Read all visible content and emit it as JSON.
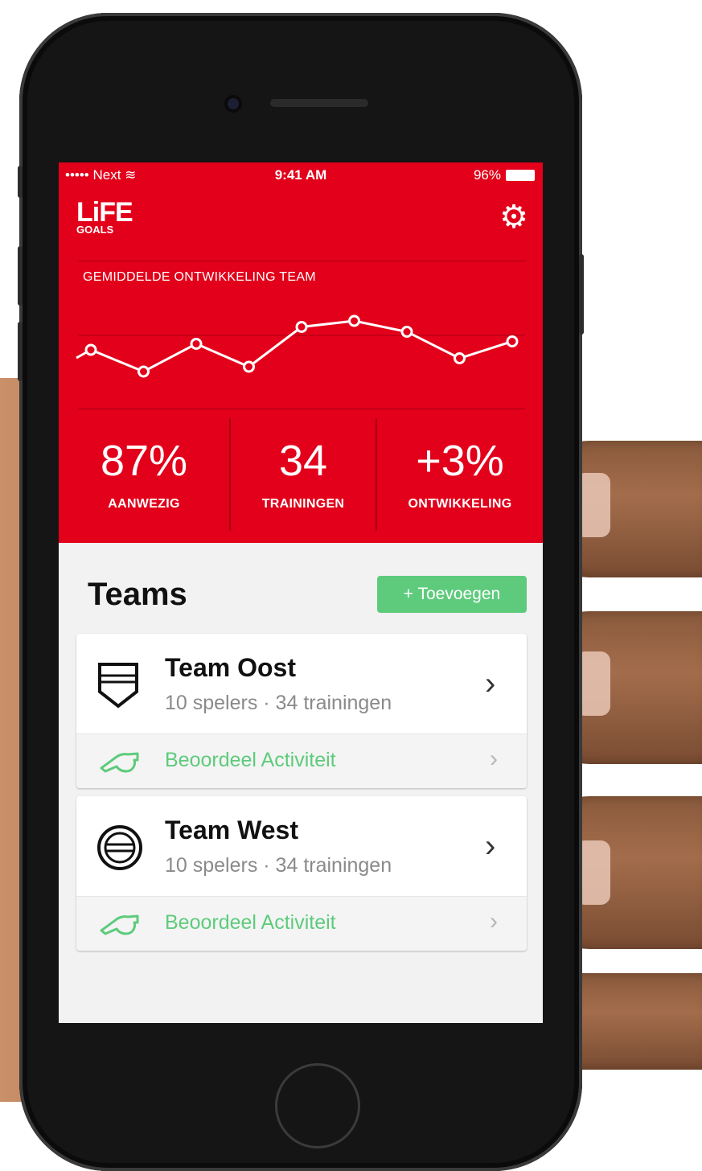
{
  "status_bar": {
    "carrier": "••••• Next",
    "time": "9:41 AM",
    "battery": "96%"
  },
  "header": {
    "logo_line1": "LiFE",
    "logo_line2": "GOALS",
    "settings_icon": "gear-icon"
  },
  "chart_data": {
    "type": "line",
    "title": "GEMIDDELDE ONTWIKKELING TEAM",
    "x": [
      1,
      2,
      3,
      4,
      5,
      6,
      7,
      8,
      9
    ],
    "values": [
      58,
      40,
      63,
      44,
      77,
      82,
      73,
      51,
      65
    ],
    "ylim": [
      20,
      100
    ],
    "grid": false,
    "color": "#ffffff"
  },
  "stats": [
    {
      "value": "87%",
      "label": "AANWEZIG"
    },
    {
      "value": "34",
      "label": "TRAININGEN"
    },
    {
      "value": "+3%",
      "label": "ONTWIKKELING"
    }
  ],
  "teams": {
    "title": "Teams",
    "add_label": "+ Toevoegen",
    "items": [
      {
        "name": "Team Oost",
        "meta": "10 spelers · 34 trainingen",
        "action": "Beoordeel Activiteit",
        "icon": "shield-icon"
      },
      {
        "name": "Team West",
        "meta": "10 spelers · 34 trainingen",
        "action": "Beoordeel Activiteit",
        "icon": "ball-icon"
      }
    ]
  },
  "colors": {
    "brand_red": "#e2001a",
    "accent_green": "#5ecb7c"
  }
}
